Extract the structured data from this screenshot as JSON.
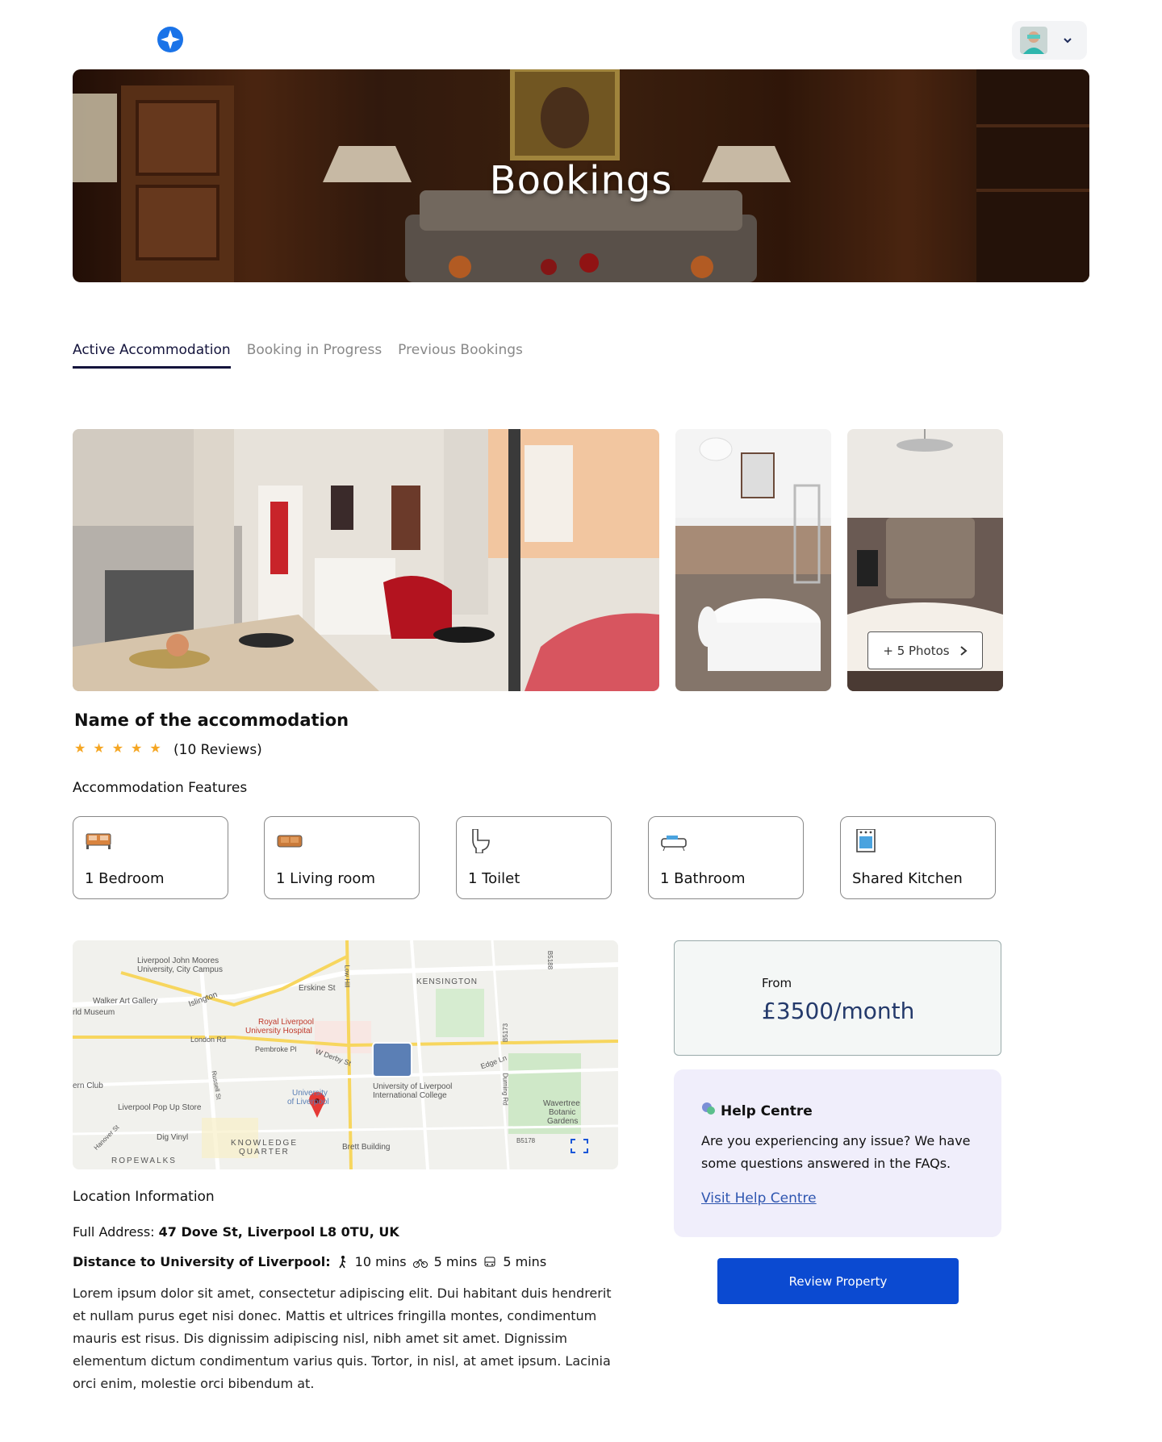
{
  "hero": {
    "title": "Bookings"
  },
  "tabs": [
    {
      "label": "Active Accommodation"
    },
    {
      "label": "Booking in Progress"
    },
    {
      "label": "Previous Bookings"
    }
  ],
  "gallery": {
    "more_photos_label": "+ 5 Photos"
  },
  "accommodation": {
    "name": "Name of the accommodation",
    "rating": 5,
    "reviews_label": "(10 Reviews)"
  },
  "features": {
    "title": "Accommodation Features",
    "items": [
      {
        "label": "1 Bedroom",
        "icon": "bed-icon"
      },
      {
        "label": "1 Living room",
        "icon": "sofa-icon"
      },
      {
        "label": "1 Toilet",
        "icon": "toilet-icon"
      },
      {
        "label": "1 Bathroom",
        "icon": "bathtub-icon"
      },
      {
        "label": "Shared Kitchen",
        "icon": "oven-icon"
      }
    ]
  },
  "map": {
    "labels": {
      "ljmu": "Liverpool John Moores",
      "ljmu2": "University, City Campus",
      "walker": "Walker Art Gallery",
      "world": "rld Museum",
      "islington": "Islington",
      "erskine": "Erskine St",
      "kensington": "KENSINGTON",
      "royal": "Royal Liverpool",
      "royal2": "University Hospital",
      "london_rd": "London Rd",
      "pembroke": "Pembroke Pl",
      "wderby": "W Derby St",
      "edge": "Edge Ln",
      "uni_college": "University of Liverpool",
      "uni_college2": "International College",
      "uol": "University",
      "uol2": "of Liverpool",
      "fern": "ern Club",
      "popup": "Liverpool Pop Up Store",
      "wavertree": "Wavertree",
      "wavertree2": "Botanic",
      "wavertree3": "Gardens",
      "dig": "Dig Vinyl",
      "kq": "KNOWLEDGE",
      "kq2": "QUARTER",
      "brett": "Brett Building",
      "rope": "ROPEWALKS",
      "low_hill": "Low Hill",
      "b5173": "B5173",
      "b5178": "B5178",
      "b5188": "B5188",
      "durning": "Durning Rd",
      "russell": "Russell St",
      "hanover": "Hanover St"
    }
  },
  "location": {
    "title": "Location Information",
    "address_label": "Full Address: ",
    "address_value": "47 Dove St, Liverpool L8 0TU, UK",
    "distance_label": "Distance to University of Liverpool:",
    "walk": "10 mins",
    "bike": "5 mins",
    "bus": "5 mins",
    "description": "Lorem ipsum dolor sit amet, consectetur adipiscing elit. Dui habitant duis hendrerit et nullam purus eget nisi donec. Mattis et ultrices fringilla montes, condimentum mauris est risus. Dis dignissim adipiscing nisl, nibh amet sit amet. Dignissim elementum dictum condimentum varius quis. Tortor, in nisl, at amet ipsum. Lacinia orci enim, molestie orci bibendum at."
  },
  "price": {
    "from_label": "From",
    "value": "£3500/month"
  },
  "help": {
    "title": "Help Centre",
    "text": "Are you experiencing any issue? We have some questions answered in the FAQs.",
    "link": "Visit Help Centre"
  },
  "actions": {
    "review_label": "Review Property"
  },
  "colors": {
    "primary": "#0b4ad1",
    "tab_active": "#14143c",
    "star": "#f5a623",
    "price": "#243a6b",
    "help_bg": "#f0eefb"
  }
}
